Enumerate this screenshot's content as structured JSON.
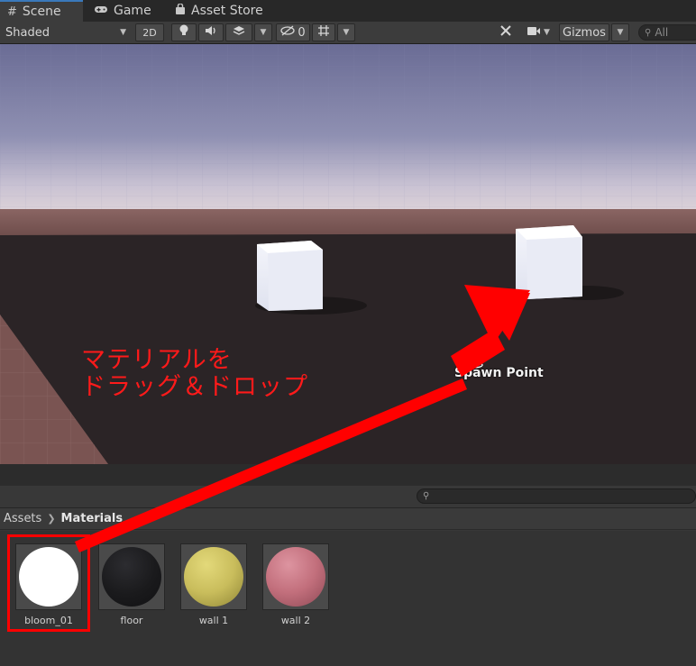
{
  "tabs": [
    {
      "label": "Scene",
      "icon": "grid-icon",
      "active": true
    },
    {
      "label": "Game",
      "icon": "gamepad-icon",
      "active": false
    },
    {
      "label": "Asset Store",
      "icon": "shopping-bag-icon",
      "active": false
    }
  ],
  "toolbar": {
    "shading_mode": "Shaded",
    "mode_2d": "2D",
    "hidden_count": "0",
    "gizmos_label": "Gizmos",
    "search_placeholder": "All"
  },
  "scene": {
    "spawn_point_label": "Spawn Point",
    "annotation_line1": "マテリアルを",
    "annotation_line2": "ドラッグ＆ドロップ",
    "colors": {
      "sky_top": "#6f7199",
      "horizon": "#d6cbd7",
      "ground_far": "#7b5a58",
      "floor": "#2b2426",
      "arrow": "#ff0000"
    }
  },
  "project": {
    "breadcrumb_root": "Assets",
    "breadcrumb_current": "Materials",
    "assets": [
      {
        "name": "bloom_01",
        "color": "#ffffff",
        "selected": true
      },
      {
        "name": "floor",
        "color": "#1a1a1c",
        "selected": false
      },
      {
        "name": "wall 1",
        "color": "#c9bd5c",
        "selected": false
      },
      {
        "name": "wall 2",
        "color": "#c26f7c",
        "selected": false
      }
    ]
  }
}
